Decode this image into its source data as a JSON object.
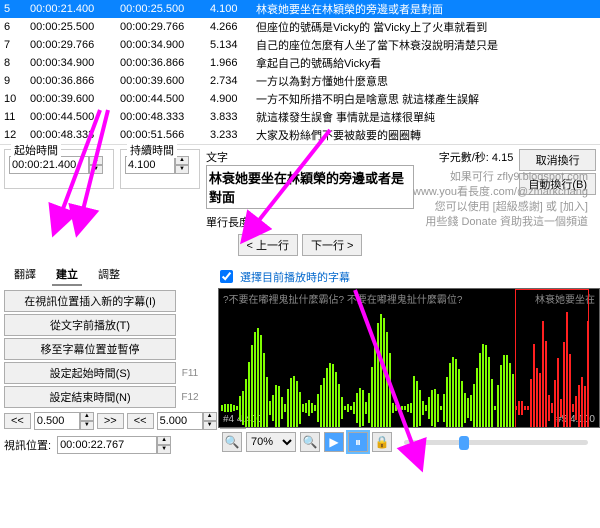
{
  "subtitle_table": {
    "rows": [
      {
        "no": "5",
        "start": "00:00:21.400",
        "end": "00:00:25.500",
        "dur": "4.100",
        "text": "林衰她要坐在林穎榮的旁邊或者是對面"
      },
      {
        "no": "6",
        "start": "00:00:25.500",
        "end": "00:00:29.766",
        "dur": "4.266",
        "text": "但座位的號碼是Vicky的 當Vicky上了火車就看到"
      },
      {
        "no": "7",
        "start": "00:00:29.766",
        "end": "00:00:34.900",
        "dur": "5.134",
        "text": "自己的座位怎麼有人坐了當下林衰沒說明清楚只是"
      },
      {
        "no": "8",
        "start": "00:00:34.900",
        "end": "00:00:36.866",
        "dur": "1.966",
        "text": "拿起自己的號碼給Vicky看"
      },
      {
        "no": "9",
        "start": "00:00:36.866",
        "end": "00:00:39.600",
        "dur": "2.734",
        "text": "一方以為對方懂她什麼意思"
      },
      {
        "no": "10",
        "start": "00:00:39.600",
        "end": "00:00:44.500",
        "dur": "4.900",
        "text": "一方不知所措不明白是啥意思 就這樣產生誤解"
      },
      {
        "no": "11",
        "start": "00:00:44.500",
        "end": "00:00:48.333",
        "dur": "3.833",
        "text": "就這樣發生誤會 事情就是這樣很單純"
      },
      {
        "no": "12",
        "start": "00:00:48.333",
        "end": "00:00:51.566",
        "dur": "3.233",
        "text": "大家及粉絲們不要被敲要的圈圈轉"
      }
    ],
    "selected_index": 0
  },
  "mid": {
    "start_group": "起始時間",
    "start_value": "00:00:21.400",
    "dur_group": "持續時間",
    "dur_value": "4.100",
    "text_label": "文字",
    "text_value": "林衰她要坐在林穎榮的旁邊或者是對面",
    "linelen_label": "單行長度",
    "cps_label": "字元數/秒:",
    "cps_value": "4.15",
    "btn_undo": "取消換行",
    "btn_autobreak": "自動換行(B)",
    "btn_prev": "< 上一行",
    "btn_next": "下一行 >"
  },
  "channel": {
    "l1": "如果可行 zfly9.blogspot.com",
    "l2": "www.you看長度.com/@zmarkchang",
    "l3": "您可以使用 [超級感謝] 或 [加入]",
    "l4": "用些錢 Donate 資助我這一個頻道"
  },
  "tabs": {
    "translate": "翻譯",
    "create": "建立",
    "adjust": "調整"
  },
  "checkbox_label": "選擇目前播放時的字幕",
  "left_panel": {
    "btn_insert": "在視訊位置插入新的字幕(I)",
    "btn_playtext": "從文字前播放(T)",
    "btn_moveto": "移至字幕位置並暫停",
    "btn_setstart": "設定起始時間(S)",
    "btn_setend": "設定結束時間(N)",
    "key_f11": "F11",
    "key_f12": "F12",
    "step_a": "0.500",
    "step_b": "5.000",
    "btn_back": "<<",
    "btn_fwd": ">>",
    "viewpos_label": "視訊位置:",
    "viewpos_value": "00:00:22.767"
  },
  "waveform": {
    "q1": "?不要在嘟裡鬼扯什麼霸佔? 不要在嘟裡鬼扯什麼霸位?",
    "q2": "林衰她要坐在",
    "label_left": "#4  4.400",
    "label_right": "#5  4.100"
  },
  "toolbar": {
    "zoom_value": "70%"
  }
}
